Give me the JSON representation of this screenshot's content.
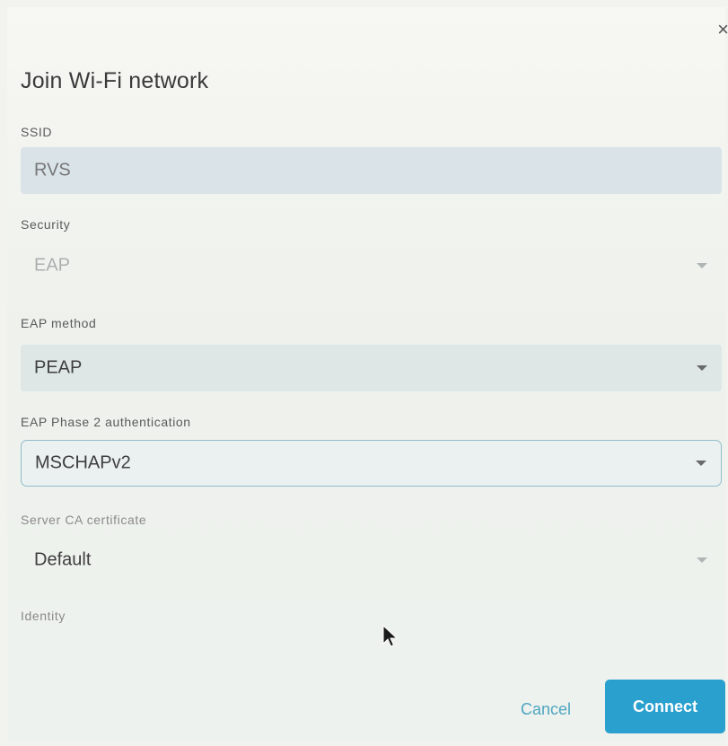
{
  "dialog": {
    "title": "Join Wi-Fi network",
    "close_glyph": "×"
  },
  "fields": {
    "ssid": {
      "label": "SSID",
      "value": "RVS"
    },
    "security": {
      "label": "Security",
      "value": "EAP"
    },
    "eap_method": {
      "label": "EAP method",
      "value": "PEAP"
    },
    "eap_phase2": {
      "label": "EAP Phase 2 authentication",
      "value": "MSCHAPv2"
    },
    "server_ca": {
      "label": "Server CA certificate",
      "value": "Default"
    },
    "identity": {
      "label": "Identity",
      "value": ""
    }
  },
  "buttons": {
    "cancel": "Cancel",
    "connect": "Connect"
  },
  "colors": {
    "accent": "#2aa0cf",
    "accent_text": "#4da5c0",
    "focus_border": "#8fbecb"
  },
  "icons": {
    "close": "close-icon",
    "dropdown": "chevron-down-icon",
    "pointer": "mouse-pointer-icon"
  }
}
